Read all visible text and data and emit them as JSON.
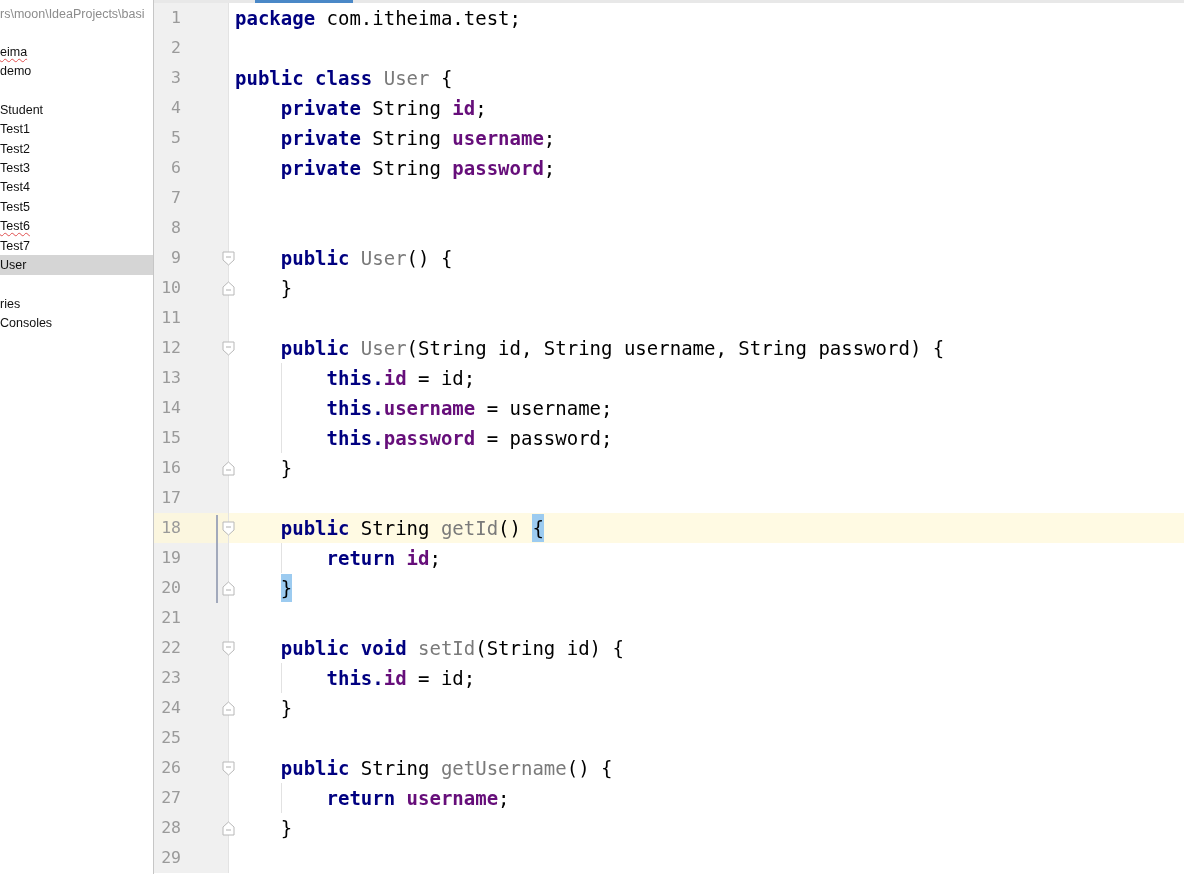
{
  "project_panel": {
    "path": "rs\\moon\\IdeaProjects\\basi",
    "sections": [
      {
        "items": [
          {
            "label": "eima",
            "selected": false,
            "misspelled": true
          },
          {
            "label": "demo",
            "selected": false,
            "misspelled": false
          }
        ]
      },
      {
        "items": [
          {
            "label": "Student",
            "selected": false,
            "misspelled": false
          },
          {
            "label": "Test1",
            "selected": false,
            "misspelled": false
          },
          {
            "label": "Test2",
            "selected": false,
            "misspelled": false
          },
          {
            "label": "Test3",
            "selected": false,
            "misspelled": false
          },
          {
            "label": "Test4",
            "selected": false,
            "misspelled": false
          },
          {
            "label": "Test5",
            "selected": false,
            "misspelled": false
          },
          {
            "label": "Test6",
            "selected": false,
            "misspelled": true
          },
          {
            "label": "Test7",
            "selected": false,
            "misspelled": false
          },
          {
            "label": "User",
            "selected": true,
            "misspelled": false
          }
        ]
      },
      {
        "items": [
          {
            "label": "ries",
            "selected": false,
            "misspelled": false
          },
          {
            "label": "Consoles",
            "selected": false,
            "misspelled": false
          }
        ]
      }
    ]
  },
  "editor": {
    "lines": [
      {
        "number": "1",
        "current": false,
        "fold_start": false,
        "fold_end": false,
        "tokens": [
          {
            "kind": "keyword",
            "text": "package"
          },
          {
            "kind": "plain",
            "text": " com.itheima.test;"
          }
        ]
      },
      {
        "number": "2",
        "current": false,
        "fold_start": false,
        "fold_end": false
      },
      {
        "number": "3",
        "current": false,
        "fold_start": false,
        "fold_end": false,
        "tokens": [
          {
            "kind": "keyword",
            "text": "public class"
          },
          {
            "kind": "method",
            "text": " User"
          },
          {
            "kind": "plain",
            "text": " {"
          }
        ],
        "children": [
          {
            "number": "4",
            "current": false,
            "fold_start": false,
            "fold_end": false,
            "tokens": [
              {
                "kind": "keyword",
                "text": "private"
              },
              {
                "kind": "plain",
                "text": " String "
              },
              {
                "kind": "field",
                "text": "id"
              },
              {
                "kind": "plain",
                "text": ";"
              }
            ]
          },
          {
            "number": "5",
            "current": false,
            "fold_start": false,
            "fold_end": false,
            "tokens": [
              {
                "kind": "keyword",
                "text": "private"
              },
              {
                "kind": "plain",
                "text": " String "
              },
              {
                "kind": "field",
                "text": "username"
              },
              {
                "kind": "plain",
                "text": ";"
              }
            ]
          },
          {
            "number": "6",
            "current": false,
            "fold_start": false,
            "fold_end": false,
            "tokens": [
              {
                "kind": "keyword",
                "text": "private"
              },
              {
                "kind": "plain",
                "text": " String "
              },
              {
                "kind": "field",
                "text": "password"
              },
              {
                "kind": "plain",
                "text": ";"
              }
            ]
          },
          {
            "number": "7",
            "current": false,
            "fold_start": false,
            "fold_end": false
          },
          {
            "number": "8",
            "current": false,
            "fold_start": false,
            "fold_end": false
          },
          {
            "number": "9",
            "current": false,
            "fold_start": true,
            "fold_end": false,
            "tokens": [
              {
                "kind": "keyword",
                "text": "public"
              },
              {
                "kind": "method",
                "text": " User"
              },
              {
                "kind": "plain",
                "text": "() {"
              }
            ]
          },
          {
            "number": "10",
            "current": false,
            "fold_start": false,
            "fold_end": true,
            "tokens": [
              {
                "kind": "plain",
                "text": "}"
              }
            ]
          },
          {
            "number": "11",
            "current": false,
            "fold_start": false,
            "fold_end": false
          },
          {
            "number": "12",
            "current": false,
            "fold_start": true,
            "fold_end": false,
            "tokens": [
              {
                "kind": "keyword",
                "text": "public"
              },
              {
                "kind": "method",
                "text": " User"
              },
              {
                "kind": "plain",
                "text": "(String id, String username, String password) {"
              }
            ],
            "children": [
              {
                "number": "13",
                "current": false,
                "fold_start": false,
                "fold_end": false,
                "tokens": [
                  {
                    "kind": "keyword",
                    "text": "this."
                  },
                  {
                    "kind": "field",
                    "text": "id"
                  },
                  {
                    "kind": "plain",
                    "text": " = id;"
                  }
                ]
              },
              {
                "number": "14",
                "current": false,
                "fold_start": false,
                "fold_end": false,
                "tokens": [
                  {
                    "kind": "keyword",
                    "text": "this."
                  },
                  {
                    "kind": "field",
                    "text": "username"
                  },
                  {
                    "kind": "plain",
                    "text": " = username;"
                  }
                ]
              },
              {
                "number": "15",
                "current": false,
                "fold_start": false,
                "fold_end": false,
                "tokens": [
                  {
                    "kind": "keyword",
                    "text": "this."
                  },
                  {
                    "kind": "field",
                    "text": "password"
                  },
                  {
                    "kind": "plain",
                    "text": " = password;"
                  }
                ]
              }
            ]
          },
          {
            "number": "16",
            "current": false,
            "fold_start": false,
            "fold_end": true,
            "tokens": [
              {
                "kind": "plain",
                "text": "}"
              }
            ]
          },
          {
            "number": "17",
            "current": false,
            "fold_start": false,
            "fold_end": false
          },
          {
            "number": "18",
            "current": true,
            "fold_start": true,
            "fold_end": false,
            "tokens": [
              {
                "kind": "keyword",
                "text": "public"
              },
              {
                "kind": "plain",
                "text": " String "
              },
              {
                "kind": "method",
                "text": "getId"
              },
              {
                "kind": "plain",
                "text": "() "
              },
              {
                "kind": "matched_brace",
                "text": "{"
              }
            ],
            "children": [
              {
                "number": "19",
                "current": false,
                "fold_start": false,
                "fold_end": false,
                "tokens": [
                  {
                    "kind": "keyword",
                    "text": "return"
                  },
                  {
                    "kind": "field",
                    "text": " id"
                  },
                  {
                    "kind": "plain",
                    "text": ";"
                  }
                ]
              }
            ]
          },
          {
            "number": "20",
            "current": false,
            "fold_start": false,
            "fold_end": true,
            "tokens": [
              {
                "kind": "matched_brace",
                "text": "}"
              }
            ]
          },
          {
            "number": "21",
            "current": false,
            "fold_start": false,
            "fold_end": false
          },
          {
            "number": "22",
            "current": false,
            "fold_start": true,
            "fold_end": false,
            "tokens": [
              {
                "kind": "keyword",
                "text": "public void"
              },
              {
                "kind": "method",
                "text": " setId"
              },
              {
                "kind": "plain",
                "text": "(String id) {"
              }
            ],
            "children": [
              {
                "number": "23",
                "current": false,
                "fold_start": false,
                "fold_end": false,
                "tokens": [
                  {
                    "kind": "keyword",
                    "text": "this."
                  },
                  {
                    "kind": "field",
                    "text": "id"
                  },
                  {
                    "kind": "plain",
                    "text": " = id;"
                  }
                ]
              }
            ]
          },
          {
            "number": "24",
            "current": false,
            "fold_start": false,
            "fold_end": true,
            "tokens": [
              {
                "kind": "plain",
                "text": "}"
              }
            ]
          },
          {
            "number": "25",
            "current": false,
            "fold_start": false,
            "fold_end": false
          },
          {
            "number": "26",
            "current": false,
            "fold_start": true,
            "fold_end": false,
            "tokens": [
              {
                "kind": "keyword",
                "text": "public"
              },
              {
                "kind": "plain",
                "text": " String "
              },
              {
                "kind": "method",
                "text": "getUsername"
              },
              {
                "kind": "plain",
                "text": "() {"
              }
            ],
            "children": [
              {
                "number": "27",
                "current": false,
                "fold_start": false,
                "fold_end": false,
                "tokens": [
                  {
                    "kind": "keyword",
                    "text": "return"
                  },
                  {
                    "kind": "field",
                    "text": " username"
                  },
                  {
                    "kind": "plain",
                    "text": ";"
                  }
                ]
              }
            ]
          },
          {
            "number": "28",
            "current": false,
            "fold_start": false,
            "fold_end": true,
            "tokens": [
              {
                "kind": "plain",
                "text": "}"
              }
            ]
          },
          {
            "number": "29",
            "current": false,
            "fold_start": false,
            "fold_end": false
          }
        ]
      }
    ]
  }
}
